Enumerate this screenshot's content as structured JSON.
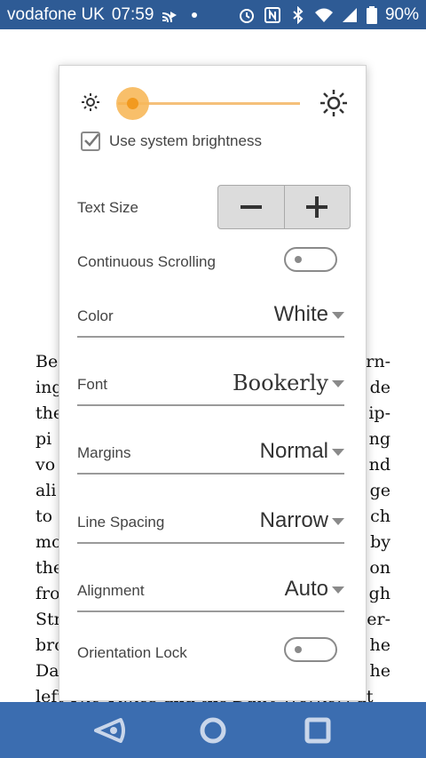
{
  "status_bar": {
    "carrier": "vodafone UK",
    "time": "07:59",
    "battery": "90%",
    "icons": [
      "cast-icon",
      "dot-icon",
      "alarm-icon",
      "nfc-icon",
      "bluetooth-icon",
      "wifi-icon",
      "signal-icon",
      "battery-icon"
    ]
  },
  "reader": {
    "lines": [
      [
        "Be",
        "rn-"
      ],
      [
        "ing",
        "de"
      ],
      [
        "the",
        "ip-"
      ],
      [
        "pi",
        "ng"
      ],
      [
        "vo",
        "nd"
      ],
      [
        "ali",
        "ge"
      ],
      [
        "to",
        "ch"
      ],
      [
        "mo",
        "by"
      ],
      [
        "the",
        "on"
      ],
      [
        "fro",
        "gh"
      ],
      [
        "Str",
        "er-"
      ],
      [
        "bro",
        "he"
      ],
      [
        "Da",
        "he"
      ]
    ],
    "last_line": {
      "p1": "left ",
      "i1": "The Times",
      "p2": " and the ",
      "i2": "Daily Worker",
      "p3": "; at"
    }
  },
  "panel": {
    "brightness": {
      "level_percent": 8,
      "use_system_label": "Use system brightness",
      "use_system_checked": true
    },
    "text_size": {
      "label": "Text Size",
      "decrease": "−",
      "increase": "+"
    },
    "continuous_scrolling": {
      "label": "Continuous Scrolling",
      "on": false
    },
    "color": {
      "label": "Color",
      "value": "White"
    },
    "font": {
      "label": "Font",
      "value": "Bookerly"
    },
    "margins": {
      "label": "Margins",
      "value": "Normal"
    },
    "line_spacing": {
      "label": "Line Spacing",
      "value": "Narrow"
    },
    "alignment": {
      "label": "Alignment",
      "value": "Auto"
    },
    "orientation_lock": {
      "label": "Orientation Lock",
      "on": false
    }
  },
  "nav_bar": {
    "buttons": [
      "back-icon",
      "home-icon",
      "recents-icon"
    ]
  },
  "colors": {
    "status_bar": "#2e5b95",
    "nav_bar": "#3b6db0",
    "slider_accent": "#f29a1f"
  }
}
